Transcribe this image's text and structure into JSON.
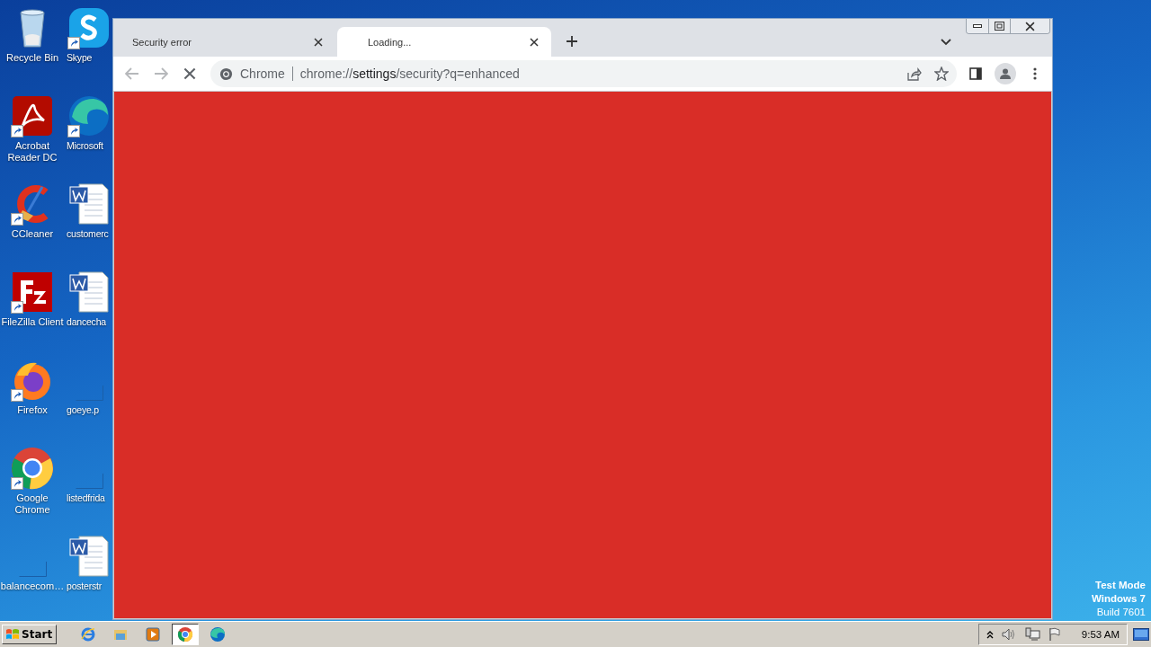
{
  "desktop": {
    "columns": [
      {
        "icons": [
          {
            "label": "Recycle Bin",
            "kind": "recycle",
            "shortcut": false
          },
          {
            "label": "Acrobat Reader DC",
            "kind": "acrobat",
            "shortcut": true
          },
          {
            "label": "CCleaner",
            "kind": "ccleaner",
            "shortcut": true
          },
          {
            "label": "FileZilla Client",
            "kind": "filezilla",
            "shortcut": true
          },
          {
            "label": "Firefox",
            "kind": "firefox",
            "shortcut": true
          },
          {
            "label": "Google Chrome",
            "kind": "chrome",
            "shortcut": true
          },
          {
            "label": "balancecom…",
            "kind": "blank",
            "shortcut": false
          }
        ]
      },
      {
        "icons": [
          {
            "label": "Skype",
            "kind": "skype",
            "shortcut": true
          },
          {
            "label": "Microsoft",
            "kind": "edge",
            "shortcut": true
          },
          {
            "label": "customerc",
            "kind": "word",
            "shortcut": false
          },
          {
            "label": "dancecha",
            "kind": "word",
            "shortcut": false
          },
          {
            "label": "goeye.p",
            "kind": "blank",
            "shortcut": false
          },
          {
            "label": "listedfrida",
            "kind": "blank",
            "shortcut": false
          },
          {
            "label": "posterstr",
            "kind": "word",
            "shortcut": false
          }
        ]
      }
    ],
    "system_text": [
      "Test Mode",
      "Windows 7",
      "Build 7601"
    ]
  },
  "browser": {
    "tabs": [
      {
        "title": "Security error",
        "selected": false
      },
      {
        "title": "Loading...",
        "selected": true
      }
    ],
    "nav": {
      "back_disabled": true,
      "forward_disabled": true,
      "loading": true
    },
    "address": {
      "chip": "Chrome",
      "scheme": "chrome://",
      "host": "settings",
      "path": "/security?q=enhanced"
    }
  },
  "taskbar": {
    "start": "Start",
    "apps": [
      {
        "kind": "ie",
        "selected": false
      },
      {
        "kind": "explorer",
        "selected": false
      },
      {
        "kind": "media",
        "selected": false
      },
      {
        "kind": "chrome",
        "selected": true
      },
      {
        "kind": "edge",
        "selected": false
      }
    ],
    "time": "9:53 AM"
  }
}
